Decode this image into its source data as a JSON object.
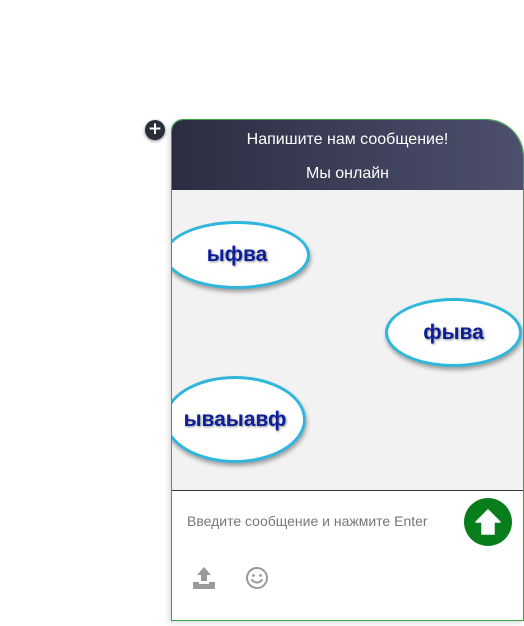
{
  "header": {
    "title": "Напишите нам сообщение!",
    "status": "Мы онлайн"
  },
  "toggle": {
    "icon": "plus-icon",
    "label": "+"
  },
  "messages": [
    {
      "text": "ыфва",
      "side": "left"
    },
    {
      "text": "фыва",
      "side": "right"
    },
    {
      "text": "ываыавф",
      "side": "left"
    }
  ],
  "composer": {
    "placeholder": "Введите сообщение и нажмите Enter",
    "value": "",
    "send_icon": "arrow-up-icon",
    "upload_icon": "upload-icon",
    "emoji_icon": "smiley-icon"
  },
  "colors": {
    "header_gradient_start": "#2b2d42",
    "header_gradient_end": "#4d506d",
    "bubble_border": "#2eb6dd",
    "bubble_text": "#0c1e9a",
    "send_button": "#087d1c",
    "widget_border": "#3aa34a"
  }
}
